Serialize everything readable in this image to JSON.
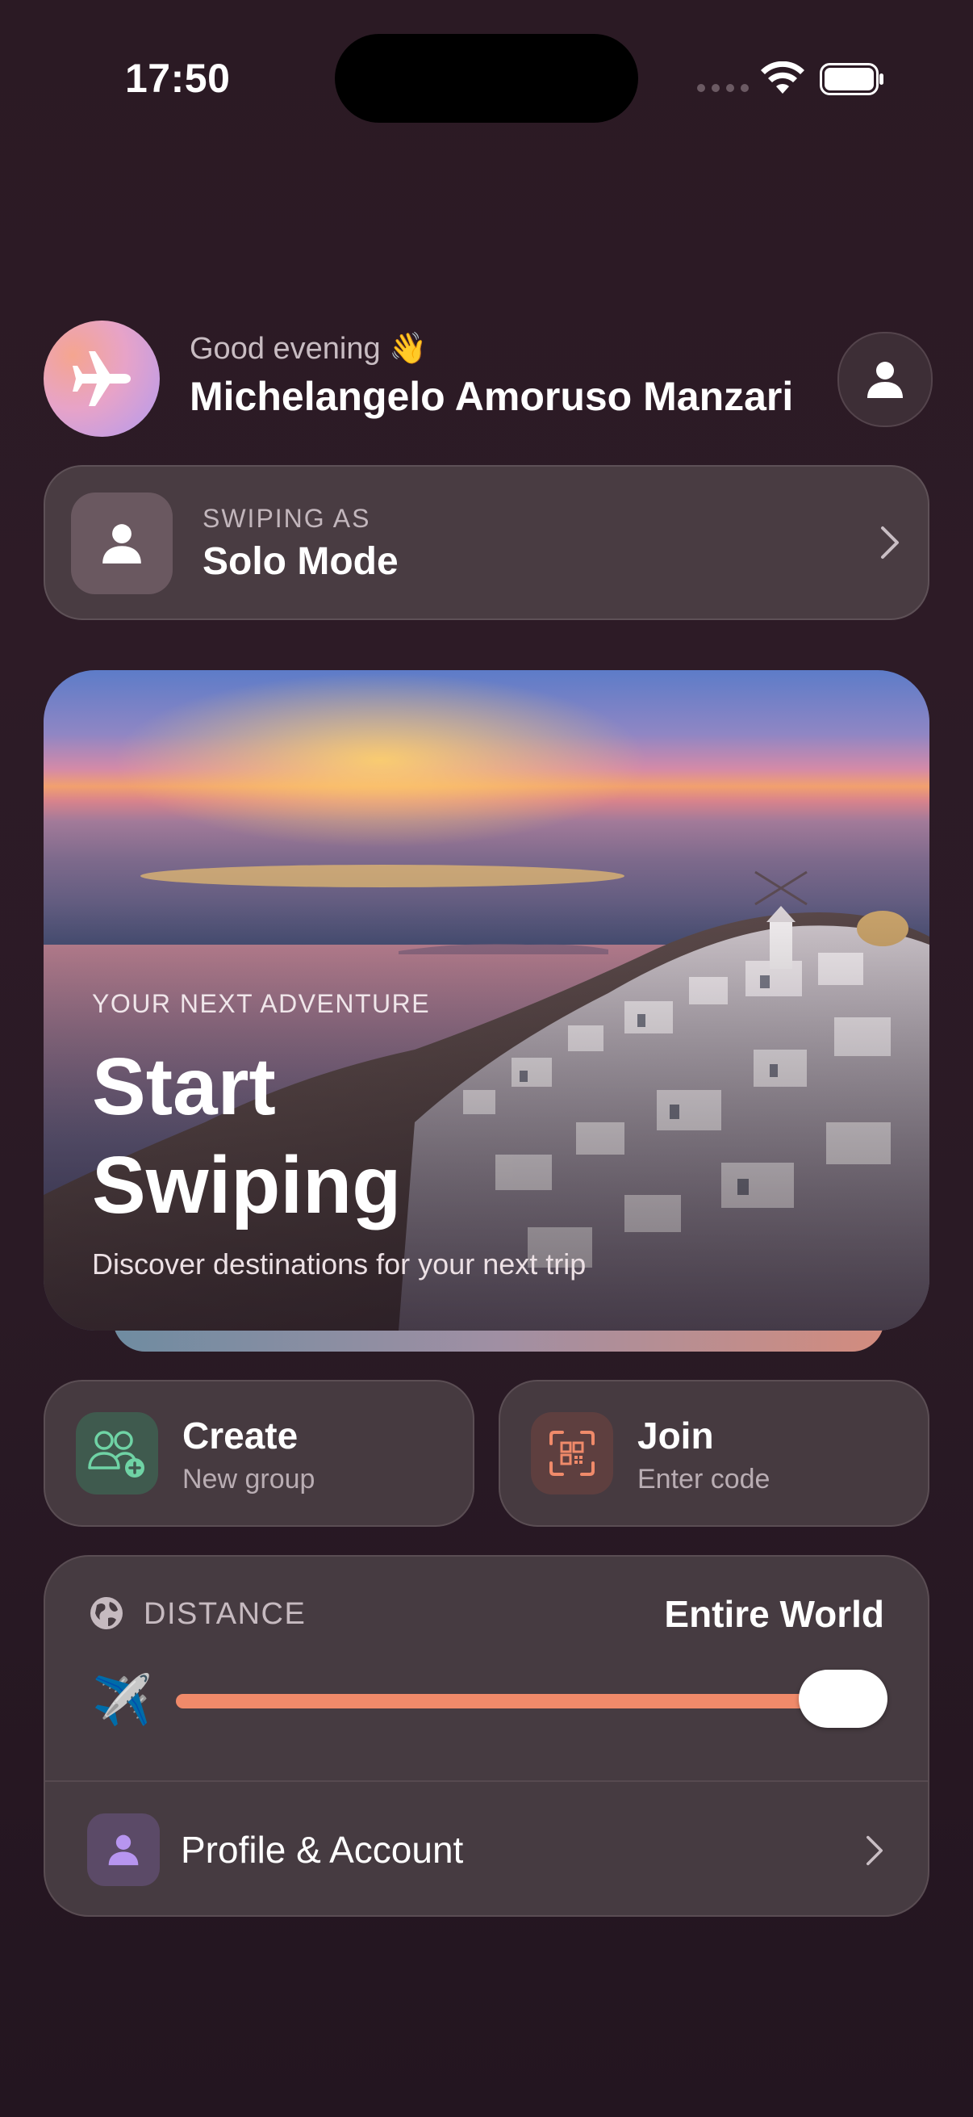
{
  "status_bar": {
    "time": "17:50"
  },
  "header": {
    "greeting": "Good evening 👋",
    "username": "Michelangelo Amoruso Manzari"
  },
  "mode": {
    "kicker": "SWIPING AS",
    "title": "Solo Mode"
  },
  "hero": {
    "kicker": "YOUR NEXT ADVENTURE",
    "title": "Start Swiping",
    "subtitle": "Discover destinations for your next trip"
  },
  "actions": [
    {
      "title": "Create",
      "subtitle": "New group",
      "icon": "add-group-icon",
      "color": "#6fd3a5"
    },
    {
      "title": "Join",
      "subtitle": "Enter code",
      "icon": "qr-scan-icon",
      "color": "#f08a6a"
    }
  ],
  "distance": {
    "label": "DISTANCE",
    "value": "Entire World",
    "slider_level": 1.0,
    "plane_emoji": "✈️",
    "accent": "#f08a6a"
  },
  "account": {
    "label": "Profile & Account",
    "icon": "person-icon",
    "color": "#b795f0"
  }
}
